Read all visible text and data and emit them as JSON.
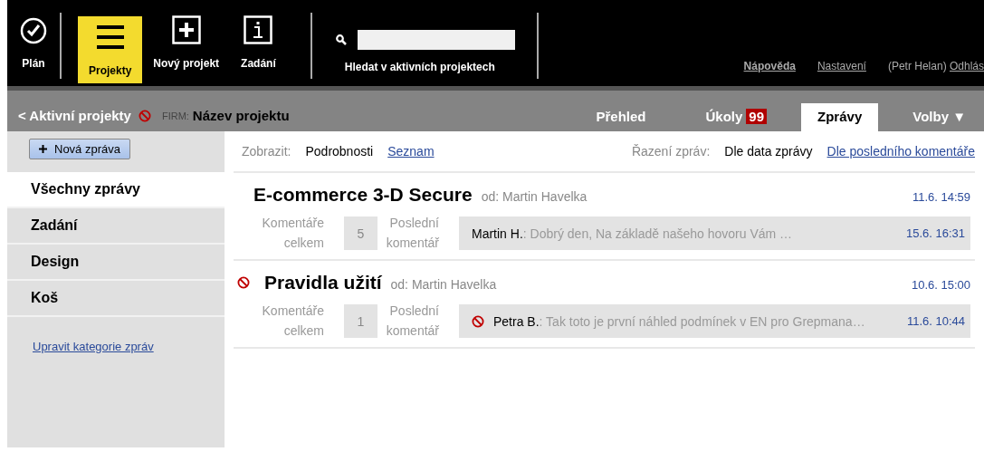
{
  "nav": {
    "items": [
      {
        "label": "Plán",
        "kind": "check",
        "selected": false
      },
      {
        "label": "Projekty",
        "kind": "menu",
        "selected": true
      },
      {
        "label": "Nový projekt",
        "kind": "plus",
        "selected": false
      },
      {
        "label": "Zadání",
        "kind": "info",
        "selected": false
      }
    ],
    "search": {
      "label": "Hledat v aktivních projektech"
    },
    "links": [
      "Nápověda",
      "Nastavení"
    ],
    "user": "(Petr Helan)",
    "logout": "Odhlás"
  },
  "project_bar": {
    "back": "< Aktivní projekty",
    "blocked": true,
    "firm_label": "FIRM:",
    "project": "Název projektu",
    "tabs": [
      {
        "label": "Přehled",
        "selected": false
      },
      {
        "label": "Úkoly",
        "badge": "99",
        "selected": false
      },
      {
        "label": "Zprávy",
        "selected": true
      },
      {
        "label": "Volby ▼",
        "selected": false
      }
    ]
  },
  "sidebar": {
    "new_button": "Nová zpráva",
    "categories": [
      {
        "label": "Všechny zprávy",
        "selected": true
      },
      {
        "label": "Zadání",
        "selected": false
      },
      {
        "label": "Design",
        "selected": false
      },
      {
        "label": "Koš",
        "selected": false
      }
    ],
    "edit_link": "Upravit kategorie zpráv"
  },
  "toolbar": {
    "view_label": "Zobrazit:",
    "view_options": [
      {
        "label": "Podrobnosti",
        "selected": true
      },
      {
        "label": "Seznam",
        "selected": false
      }
    ],
    "sort_label": "Řazení zpráv:",
    "sort_options": [
      {
        "label": "Dle data zprávy",
        "selected": true
      },
      {
        "label": "Dle posledního komentáře",
        "selected": false
      }
    ]
  },
  "messages": [
    {
      "blocked": false,
      "title": "E-commerce 3-D Secure",
      "author": "od: Martin Havelka",
      "date": "11.6. 14:59",
      "comments_label": "Komentáře celkem",
      "count": "5",
      "last_label": "Poslední komentář",
      "last_blocked": false,
      "last_author": "Martin H.",
      "last_text": ": Dobrý den, Na základě našeho hovoru Vám …",
      "last_date": "15.6. 16:31"
    },
    {
      "blocked": true,
      "title": "Pravidla užití",
      "author": "od: Martin Havelka",
      "date": "10.6. 15:00",
      "comments_label": "Komentáře celkem",
      "count": "1",
      "last_label": "Poslední komentář",
      "last_blocked": true,
      "last_author": "Petra B.",
      "last_text": ": Tak toto je první náhled podmínek v EN pro Grepmana…",
      "last_date": "11.6. 10:44"
    }
  ]
}
